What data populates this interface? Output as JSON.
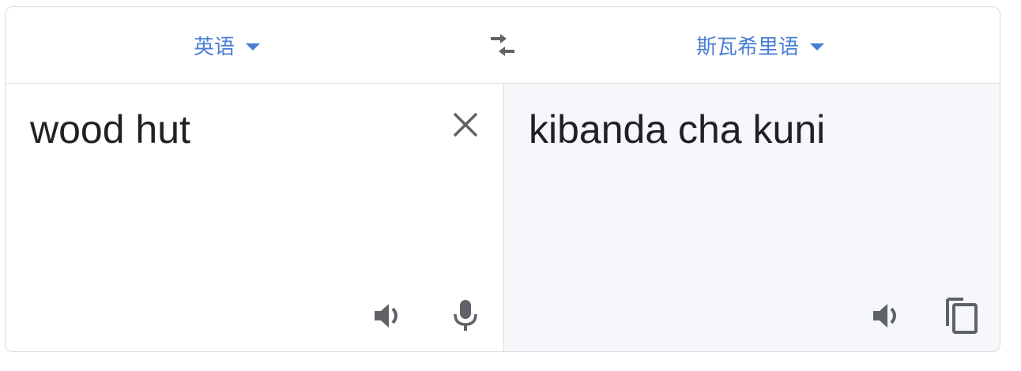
{
  "language_bar": {
    "source_language": "英语",
    "target_language": "斯瓦希里语",
    "swap_icon": "swap-horiz-icon"
  },
  "source": {
    "text": "wood hut",
    "clear_icon": "close-icon",
    "speak_icon": "volume-icon",
    "mic_icon": "microphone-icon"
  },
  "target": {
    "text": "kibanda cha kuni",
    "speak_icon": "volume-icon",
    "copy_icon": "copy-icon"
  },
  "colors": {
    "accent": "#4a7fd4",
    "icon": "#5f6368",
    "border": "#dadce0",
    "target_bg": "#f5f7fa",
    "text": "#202124"
  }
}
